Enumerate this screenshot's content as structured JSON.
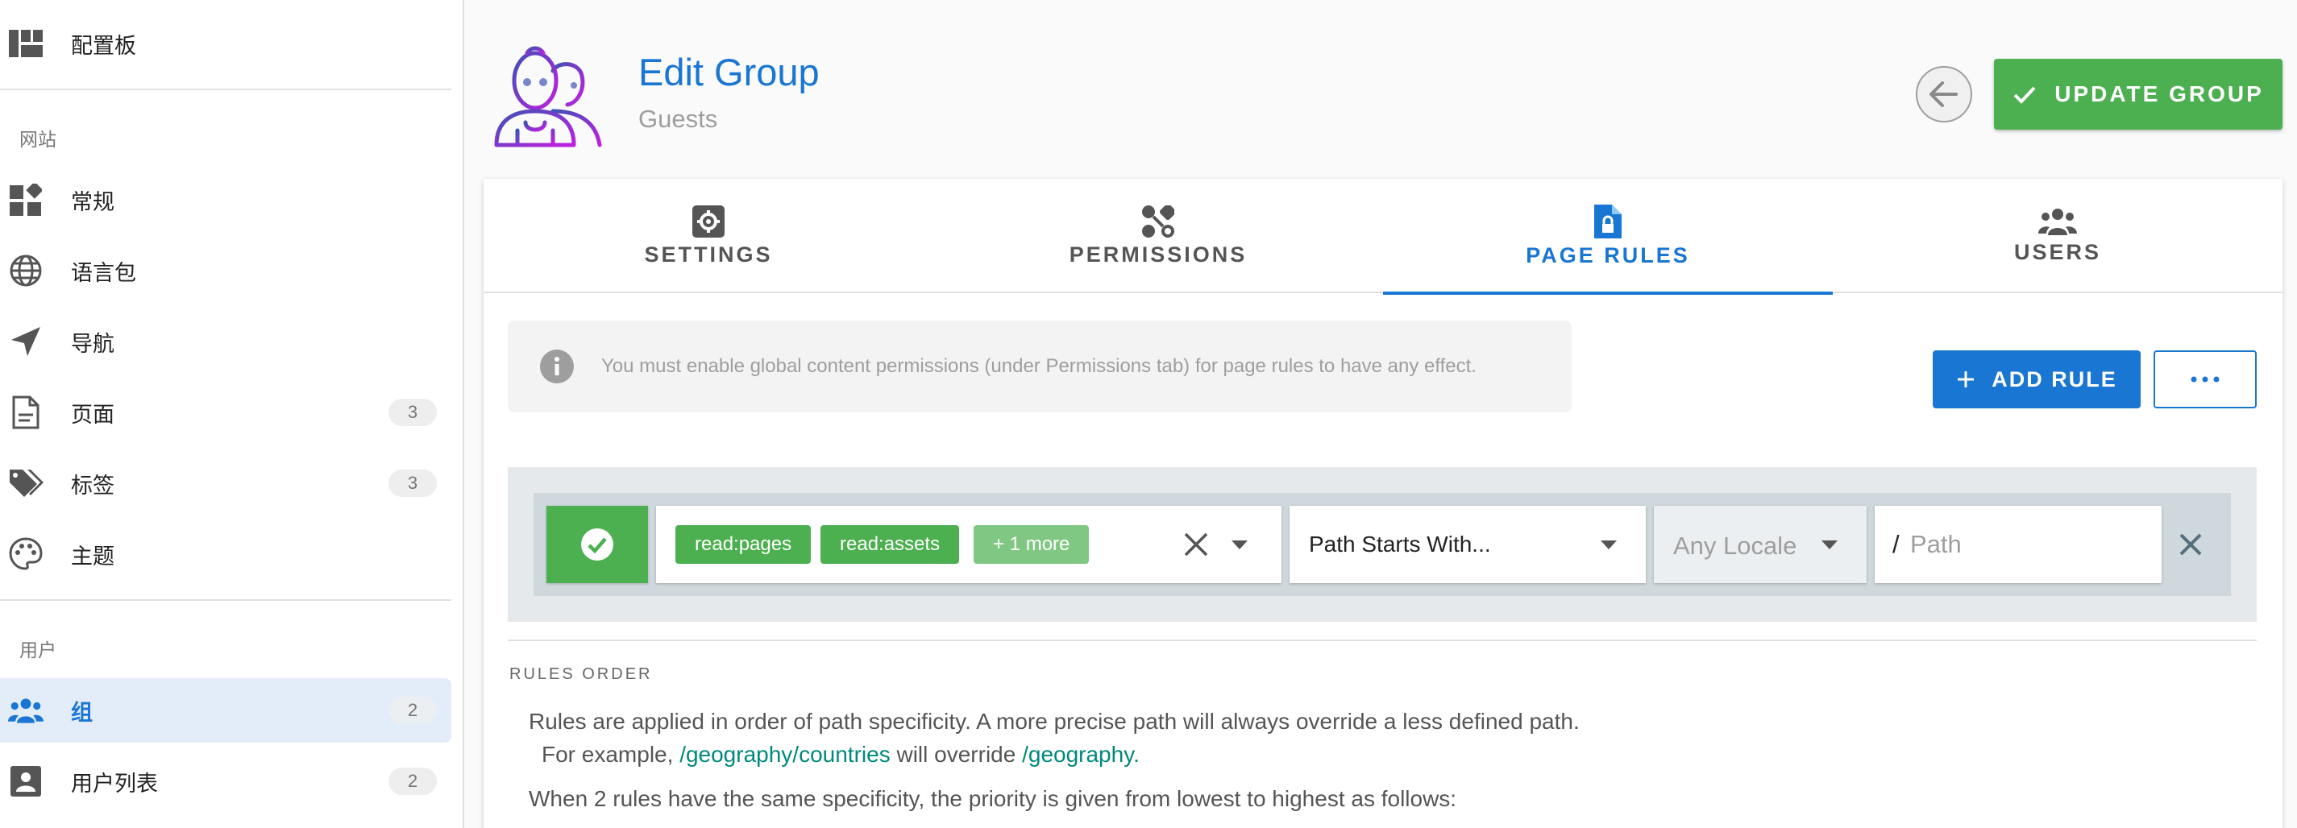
{
  "sidebar": {
    "top_item": {
      "label": "配置板",
      "icon": "dashboard-icon"
    },
    "sections": [
      {
        "header": "网站",
        "items": [
          {
            "label": "常规",
            "icon": "widgets-icon",
            "badge": ""
          },
          {
            "label": "语言包",
            "icon": "globe-icon",
            "badge": ""
          },
          {
            "label": "导航",
            "icon": "navigation-arrow-icon",
            "badge": ""
          },
          {
            "label": "页面",
            "icon": "document-icon",
            "badge": "3"
          },
          {
            "label": "标签",
            "icon": "tags-icon",
            "badge": "3"
          },
          {
            "label": "主题",
            "icon": "palette-icon",
            "badge": ""
          }
        ]
      },
      {
        "header": "用户",
        "items": [
          {
            "label": "组",
            "icon": "group-icon",
            "badge": "2",
            "active": true
          },
          {
            "label": "用户列表",
            "icon": "user-list-icon",
            "badge": "2"
          }
        ]
      }
    ]
  },
  "header": {
    "title": "Edit Group",
    "subtitle": "Guests",
    "update_label": "UPDATE GROUP",
    "avatar_icon": "group-avatar-icon"
  },
  "tabs": [
    {
      "label": "SETTINGS",
      "icon": "settings-icon"
    },
    {
      "label": "PERMISSIONS",
      "icon": "permissions-icon"
    },
    {
      "label": "PAGE RULES",
      "icon": "file-lock-icon",
      "active": true
    },
    {
      "label": "USERS",
      "icon": "users-icon"
    }
  ],
  "page_rules": {
    "alert": "You must enable global content permissions (under Permissions tab) for page rules to have any effect.",
    "add_rule_label": "ADD RULE",
    "rule": {
      "permissions": [
        "read:pages",
        "read:assets"
      ],
      "more_label": "+ 1 more",
      "match": "Path Starts With...",
      "locale": "Any Locale",
      "path_prefix": "/",
      "path_placeholder": "Path"
    },
    "order": {
      "title": "RULES ORDER",
      "line1": "Rules are applied in order of path specificity. A more precise path will always override a less defined path.",
      "line2_prefix": "For example,",
      "line2_link1": "/geography/countries",
      "line2_middle": "will override",
      "line2_link2": "/geography.",
      "line3": "When 2 rules have the same specificity, the priority is given from lowest to highest as follows:"
    }
  },
  "colors": {
    "primary": "#1976d2",
    "success": "#4caf50",
    "link": "#00897b"
  }
}
